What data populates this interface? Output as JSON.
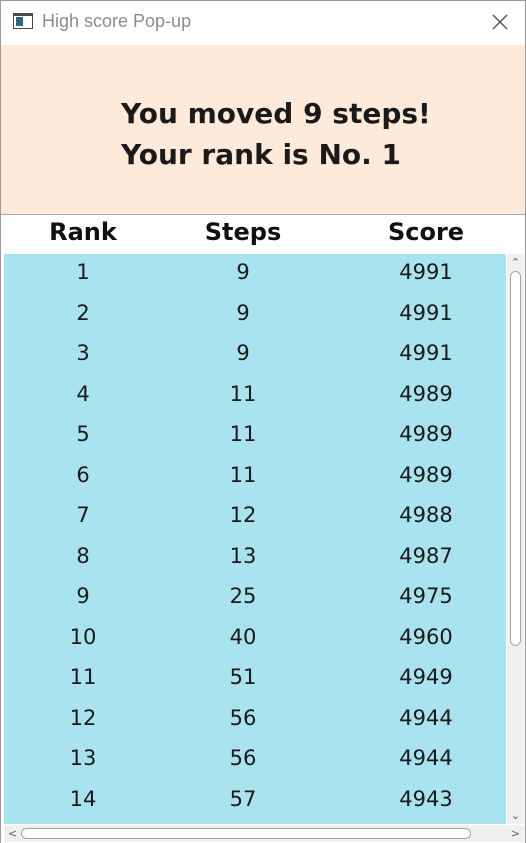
{
  "window": {
    "title": "High score Pop-up",
    "icon": "app-window-icon",
    "close_icon": "close-icon"
  },
  "message": {
    "line1": "You moved 9 steps!",
    "line2": "Your rank is No. 1"
  },
  "colors": {
    "message_bg": "#fdeadb",
    "table_bg": "#a9e3ef"
  },
  "table": {
    "headers": {
      "rank": "Rank",
      "steps": "Steps",
      "score": "Score"
    },
    "rows": [
      {
        "rank": "1",
        "steps": "9",
        "score": "4991"
      },
      {
        "rank": "2",
        "steps": "9",
        "score": "4991"
      },
      {
        "rank": "3",
        "steps": "9",
        "score": "4991"
      },
      {
        "rank": "4",
        "steps": "11",
        "score": "4989"
      },
      {
        "rank": "5",
        "steps": "11",
        "score": "4989"
      },
      {
        "rank": "6",
        "steps": "11",
        "score": "4989"
      },
      {
        "rank": "7",
        "steps": "12",
        "score": "4988"
      },
      {
        "rank": "8",
        "steps": "13",
        "score": "4987"
      },
      {
        "rank": "9",
        "steps": "25",
        "score": "4975"
      },
      {
        "rank": "10",
        "steps": "40",
        "score": "4960"
      },
      {
        "rank": "11",
        "steps": "51",
        "score": "4949"
      },
      {
        "rank": "12",
        "steps": "56",
        "score": "4944"
      },
      {
        "rank": "13",
        "steps": "56",
        "score": "4944"
      },
      {
        "rank": "14",
        "steps": "57",
        "score": "4943"
      }
    ]
  }
}
